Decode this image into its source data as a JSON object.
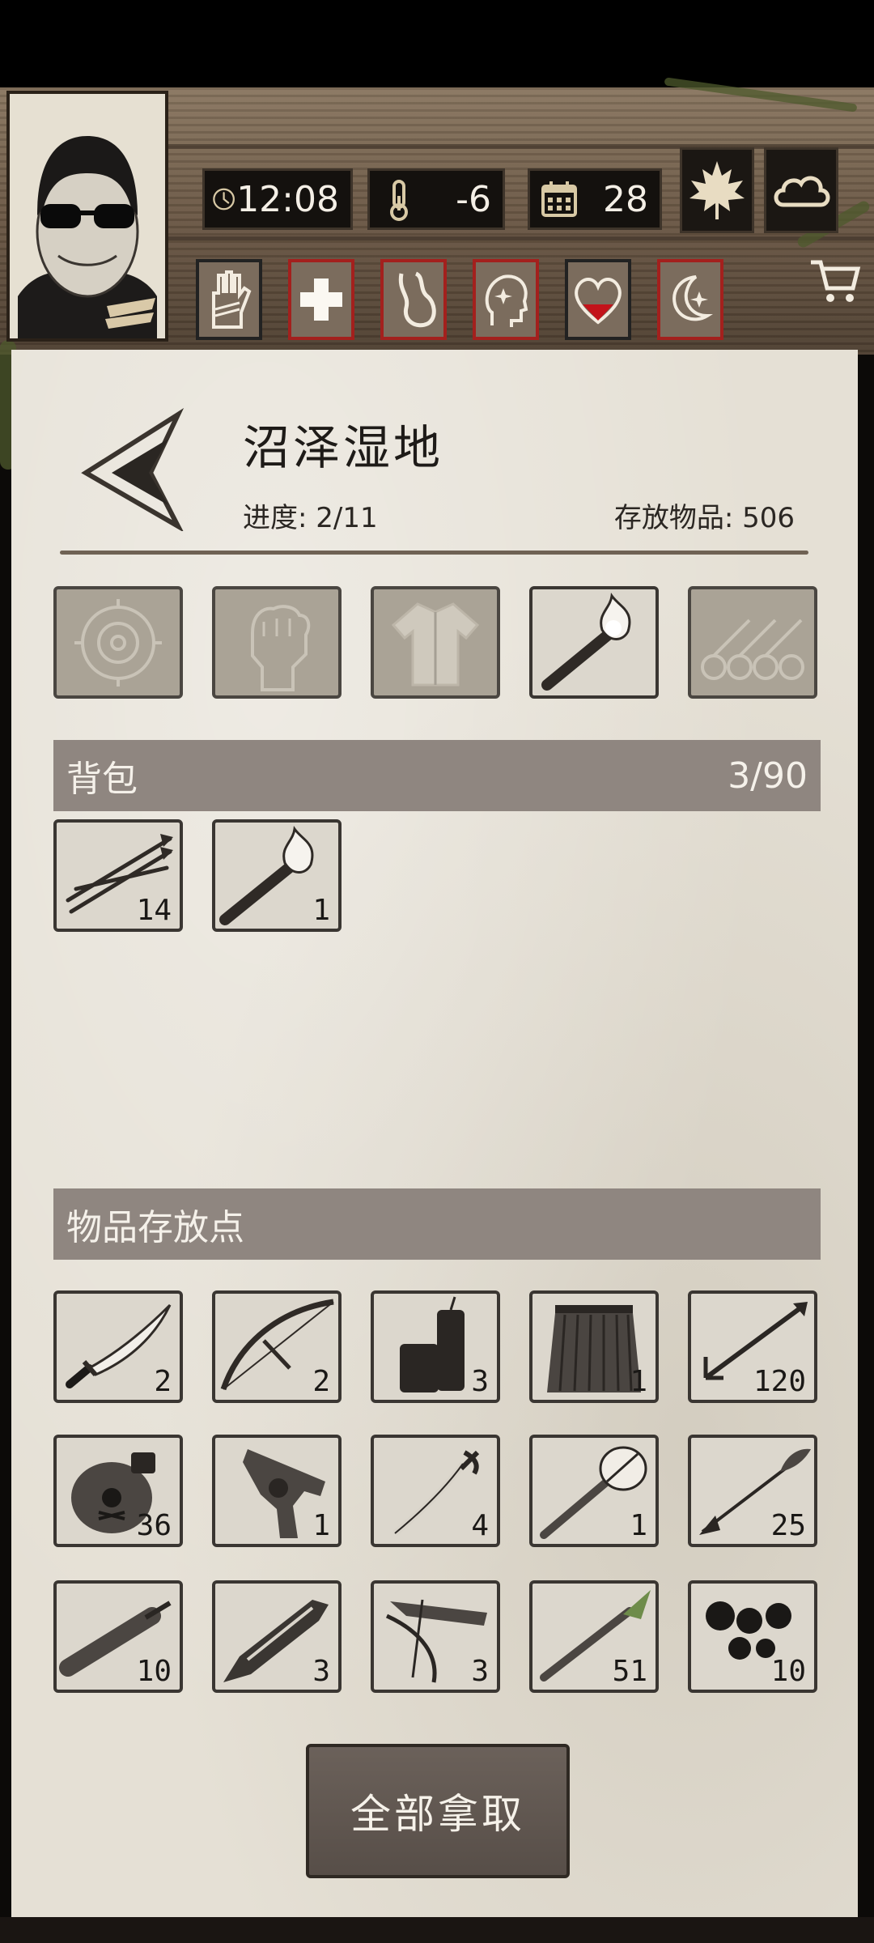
{
  "hud": {
    "time": "12:08",
    "temperature": "-6",
    "day": "28"
  },
  "status_icons": [
    "hand-bandage-icon",
    "medical-cross-icon",
    "stomach-icon",
    "head-sparkle-icon",
    "heart-icon",
    "moon-star-icon"
  ],
  "location": {
    "title": "沼泽湿地",
    "progress": "进度: 2/11",
    "stored": "存放物品: 506"
  },
  "backpack": {
    "label": "背包",
    "capacity": "3/90",
    "items": [
      {
        "icon": "arrows-icon",
        "count": "14"
      },
      {
        "icon": "torch-icon",
        "count": "1"
      }
    ]
  },
  "storage": {
    "label": "物品存放点",
    "items": [
      {
        "icon": "katana-icon",
        "count": "2"
      },
      {
        "icon": "bow-icon",
        "count": "2"
      },
      {
        "icon": "dynamite-icon",
        "count": "3"
      },
      {
        "icon": "grass-skirt-icon",
        "count": "1"
      },
      {
        "icon": "arrow-icon",
        "count": "120"
      },
      {
        "icon": "poison-jar-icon",
        "count": "36"
      },
      {
        "icon": "revolver-icon",
        "count": "1"
      },
      {
        "icon": "sabre-icon",
        "count": "4"
      },
      {
        "icon": "stone-hammer-icon",
        "count": "1"
      },
      {
        "icon": "feather-arrow-icon",
        "count": "25"
      },
      {
        "icon": "club-icon",
        "count": "10"
      },
      {
        "icon": "big-sword-icon",
        "count": "3"
      },
      {
        "icon": "crossbow-icon",
        "count": "3"
      },
      {
        "icon": "spear-icon",
        "count": "51"
      },
      {
        "icon": "iron-balls-icon",
        "count": "10"
      }
    ]
  },
  "take_all_label": "全部拿取"
}
